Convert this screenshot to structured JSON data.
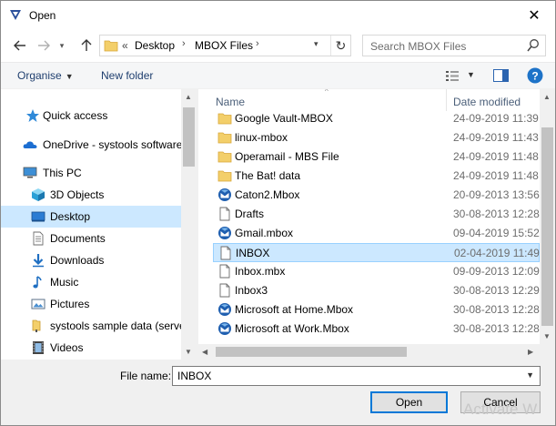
{
  "window": {
    "title": "Open"
  },
  "address": {
    "overflow": "«",
    "crumbs": [
      "Desktop",
      "MBOX Files"
    ]
  },
  "search": {
    "placeholder": "Search MBOX Files"
  },
  "toolbar": {
    "organise": "Organise",
    "new_folder": "New folder"
  },
  "nav": {
    "items": [
      {
        "label": "Quick access",
        "icon": "star-icon"
      },
      {
        "label": "OneDrive - systools software",
        "icon": "cloud-icon"
      },
      {
        "label": "This PC",
        "icon": "computer-icon"
      },
      {
        "label": "3D Objects",
        "icon": "cube-icon"
      },
      {
        "label": "Desktop",
        "icon": "desktop-icon",
        "selected": true
      },
      {
        "label": "Documents",
        "icon": "document-icon"
      },
      {
        "label": "Downloads",
        "icon": "download-icon"
      },
      {
        "label": "Music",
        "icon": "music-icon"
      },
      {
        "label": "Pictures",
        "icon": "pictures-icon"
      },
      {
        "label": "systools sample data (serve",
        "icon": "network-folder-icon"
      },
      {
        "label": "Videos",
        "icon": "video-icon"
      }
    ]
  },
  "files": {
    "col_name": "Name",
    "col_date": "Date modified",
    "rows": [
      {
        "name": "Google Vault-MBOX",
        "date": "24-09-2019 11:39",
        "icon": "folder-icon"
      },
      {
        "name": "linux-mbox",
        "date": "24-09-2019 11:43",
        "icon": "folder-icon"
      },
      {
        "name": "Operamail - MBS File",
        "date": "24-09-2019 11:48",
        "icon": "folder-icon"
      },
      {
        "name": "The Bat! data",
        "date": "24-09-2019 11:48",
        "icon": "folder-icon"
      },
      {
        "name": "Caton2.Mbox",
        "date": "20-09-2013 13:56",
        "icon": "thunderbird-icon"
      },
      {
        "name": "Drafts",
        "date": "30-08-2013 12:28",
        "icon": "file-icon"
      },
      {
        "name": "Gmail.mbox",
        "date": "09-04-2019 15:52",
        "icon": "thunderbird-icon"
      },
      {
        "name": "INBOX",
        "date": "02-04-2019 11:49",
        "icon": "file-icon",
        "selected": true
      },
      {
        "name": "Inbox.mbx",
        "date": "09-09-2013 12:09",
        "icon": "file-icon"
      },
      {
        "name": "Inbox3",
        "date": "30-08-2013 12:29",
        "icon": "file-icon"
      },
      {
        "name": "Microsoft at Home.Mbox",
        "date": "30-08-2013 12:28",
        "icon": "thunderbird-icon"
      },
      {
        "name": "Microsoft at Work.Mbox",
        "date": "30-08-2013 12:28",
        "icon": "thunderbird-icon"
      }
    ]
  },
  "bottom": {
    "file_name_label": "File name:",
    "file_name_value": "INBOX",
    "open_label": "Open",
    "cancel_label": "Cancel",
    "watermark": "Activate W"
  },
  "colors": {
    "selection": "#cce8ff",
    "selection_border": "#99d1ff",
    "accent": "#0078d7",
    "help": "#1e73c8"
  }
}
